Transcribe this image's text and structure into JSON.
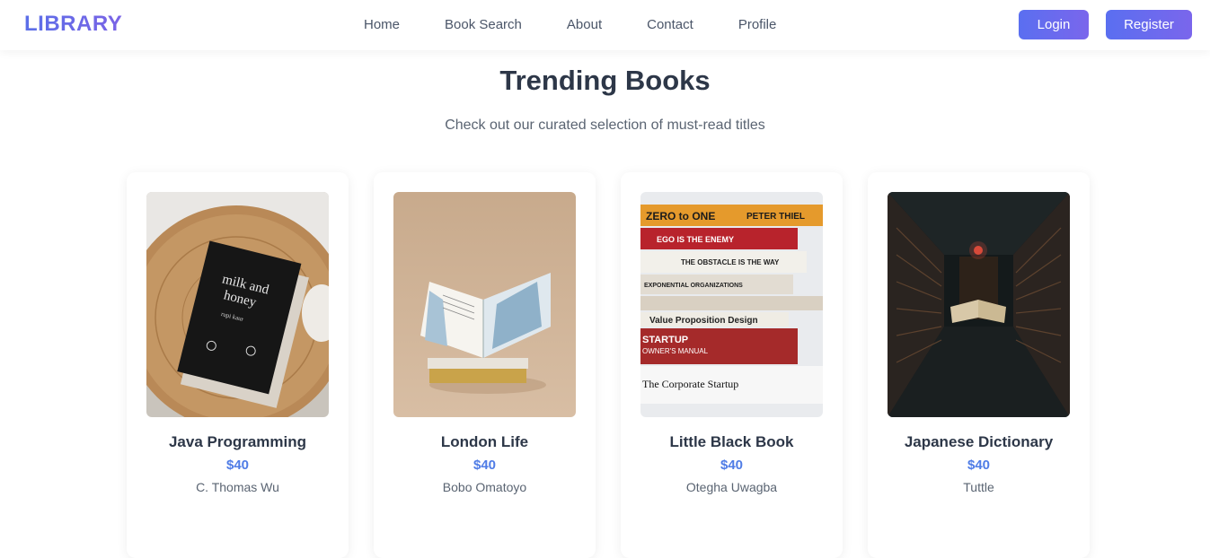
{
  "nav": {
    "logo": "LIBRARY",
    "links": [
      "Home",
      "Book Search",
      "About",
      "Contact",
      "Profile"
    ],
    "login_label": "Login",
    "register_label": "Register"
  },
  "hero": {
    "title": "Trending Books",
    "subtitle": "Check out our curated selection of must-read titles"
  },
  "books": [
    {
      "title": "Java Programming",
      "price": "$40",
      "author": "C. Thomas Wu",
      "cover_text": [
        "milk and",
        "honey",
        "rupi kaur"
      ]
    },
    {
      "title": "London Life",
      "price": "$40",
      "author": "Bobo Omatoyo"
    },
    {
      "title": "Little Black Book",
      "price": "$40",
      "author": "Otegha Uwagba",
      "cover_text": [
        "ZERO to ONE",
        "PETER THIEL",
        "EGO IS THE ENEMY",
        "THE OBSTACLE IS THE WAY",
        "EXPONENTIAL ORGANIZATIONS",
        "Value Proposition Design",
        "STARTUP",
        "OWNER'S MANUAL",
        "The Corporate Startup"
      ]
    },
    {
      "title": "Japanese Dictionary",
      "price": "$40",
      "author": "Tuttle"
    }
  ],
  "colors": {
    "accent": "#4f7ce6",
    "button_gradient_start": "#5a6ff0",
    "button_gradient_end": "#7a66ec",
    "heading": "#2d3748"
  }
}
